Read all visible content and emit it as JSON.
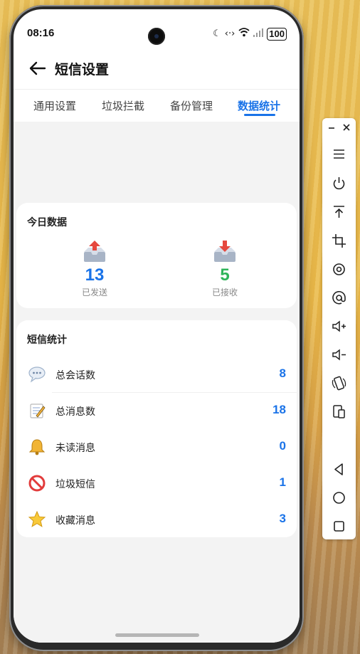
{
  "status_bar": {
    "time": "08:16",
    "battery": "100"
  },
  "header": {
    "title": "短信设置"
  },
  "tabs": [
    {
      "label": "通用设置"
    },
    {
      "label": "垃圾拦截"
    },
    {
      "label": "备份管理"
    },
    {
      "label": "数据统计",
      "active": true
    }
  ],
  "today": {
    "title": "今日数据",
    "sent": {
      "value": "13",
      "label": "已发送",
      "color": "#1a73e8"
    },
    "received": {
      "value": "5",
      "label": "已接收",
      "color": "#2fb45a"
    }
  },
  "sms_stats": {
    "title": "短信统计",
    "rows": [
      {
        "icon": "speech-bubble-icon",
        "label": "总会话数",
        "value": "8"
      },
      {
        "icon": "memo-icon",
        "label": "总消息数",
        "value": "18"
      },
      {
        "icon": "bell-icon",
        "label": "未读消息",
        "value": "0"
      },
      {
        "icon": "prohibited-icon",
        "label": "垃圾短信",
        "value": "1"
      },
      {
        "icon": "star-icon",
        "label": "收藏消息",
        "value": "3"
      }
    ]
  },
  "toolbar": {
    "items": [
      "minimize-icon",
      "close-icon",
      "menu-icon",
      "power-icon",
      "pin-top-icon",
      "crop-icon",
      "rotate-icon",
      "at-icon",
      "volume-up-icon",
      "volume-down-icon",
      "rotate-device-icon",
      "screenshot-icon",
      "back-icon",
      "home-icon",
      "recents-icon"
    ]
  }
}
